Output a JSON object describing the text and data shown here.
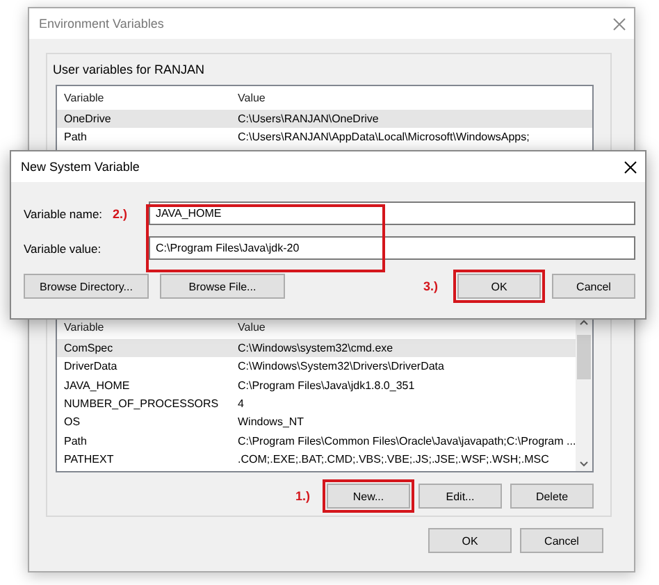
{
  "window": {
    "title": "Environment Variables"
  },
  "user_variables": {
    "title": "User variables for RANJAN",
    "columns": [
      "Variable",
      "Value"
    ],
    "rows": [
      {
        "variable": "OneDrive",
        "value": "C:\\Users\\RANJAN\\OneDrive",
        "selected": true
      },
      {
        "variable": "Path",
        "value": "C:\\Users\\RANJAN\\AppData\\Local\\Microsoft\\WindowsApps;",
        "selected": false
      }
    ]
  },
  "system_variables": {
    "columns": [
      "Variable",
      "Value"
    ],
    "rows": [
      {
        "variable": "ComSpec",
        "value": "C:\\Windows\\system32\\cmd.exe",
        "selected": true
      },
      {
        "variable": "DriverData",
        "value": "C:\\Windows\\System32\\Drivers\\DriverData",
        "selected": false
      },
      {
        "variable": "JAVA_HOME",
        "value": "C:\\Program Files\\Java\\jdk1.8.0_351",
        "selected": false
      },
      {
        "variable": "NUMBER_OF_PROCESSORS",
        "value": "4",
        "selected": false
      },
      {
        "variable": "OS",
        "value": "Windows_NT",
        "selected": false
      },
      {
        "variable": "Path",
        "value": "C:\\Program Files\\Common Files\\Oracle\\Java\\javapath;C:\\Program ...",
        "selected": false
      },
      {
        "variable": "PATHEXT",
        "value": ".COM;.EXE;.BAT;.CMD;.VBS;.VBE;.JS;.JSE;.WSF;.WSH;.MSC",
        "selected": false
      }
    ],
    "buttons": [
      {
        "label": "New...",
        "annotation": "1.)",
        "highlighted": true
      },
      {
        "label": "Edit...",
        "highlighted": false
      },
      {
        "label": "Delete",
        "highlighted": false
      }
    ]
  },
  "footer_buttons": [
    "OK",
    "Cancel"
  ],
  "dialog": {
    "title": "New System Variable",
    "fields_annotation": "2.)",
    "fields_highlighted": true,
    "fields": [
      {
        "label": "Variable name:",
        "value": "JAVA_HOME"
      },
      {
        "label": "Variable value:",
        "value": "C:\\Program Files\\Java\\jdk-20"
      }
    ],
    "browse_buttons": [
      "Browse Directory...",
      "Browse File..."
    ],
    "buttons": [
      {
        "label": "OK",
        "annotation": "3.)",
        "highlighted": true
      },
      {
        "label": "Cancel",
        "highlighted": false
      }
    ]
  }
}
